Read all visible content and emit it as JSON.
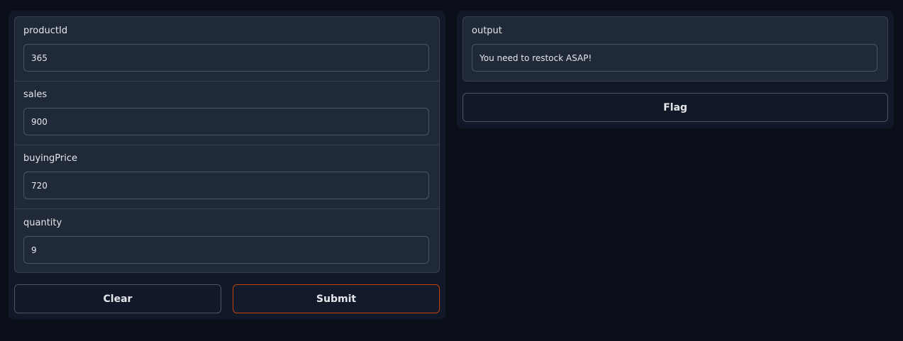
{
  "inputs": [
    {
      "label": "productId",
      "value": "365"
    },
    {
      "label": "sales",
      "value": "900"
    },
    {
      "label": "buyingPrice",
      "value": "720"
    },
    {
      "label": "quantity",
      "value": "9"
    }
  ],
  "output": {
    "label": "output",
    "value": "You need to restock ASAP!"
  },
  "buttons": {
    "clear": "Clear",
    "submit": "Submit",
    "flag": "Flag"
  },
  "colors": {
    "background": "#0b0f19",
    "panel": "#111827",
    "submit_border": "#c2410c"
  }
}
